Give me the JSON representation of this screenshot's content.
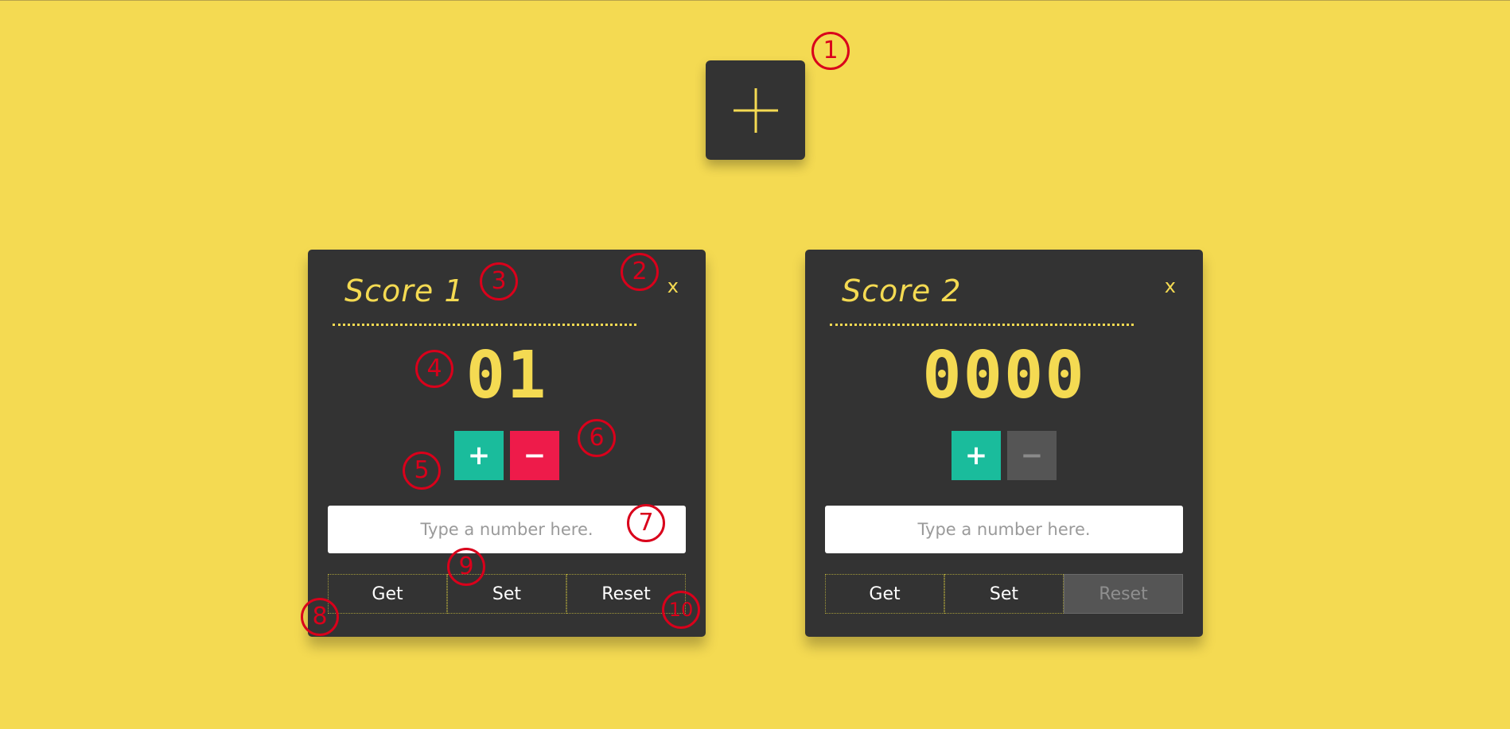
{
  "add_button": {
    "icon": "plus-icon",
    "color": "#f4da52"
  },
  "cards": [
    {
      "title": "Score 1",
      "close_label": "x",
      "score": "01",
      "plus_label": "+",
      "minus_label": "−",
      "minus_enabled": true,
      "input_placeholder": "Type a number here.",
      "input_value": "",
      "get_label": "Get",
      "set_label": "Set",
      "reset_label": "Reset",
      "reset_enabled": true
    },
    {
      "title": "Score 2",
      "close_label": "x",
      "score": "0000",
      "plus_label": "+",
      "minus_label": "−",
      "minus_enabled": false,
      "input_placeholder": "Type a number here.",
      "input_value": "",
      "get_label": "Get",
      "set_label": "Set",
      "reset_label": "Reset",
      "reset_enabled": false
    }
  ],
  "callouts": [
    "1",
    "2",
    "3",
    "4",
    "5",
    "6",
    "7",
    "8",
    "9",
    "10"
  ],
  "colors": {
    "background": "#f4da52",
    "card": "#333333",
    "accent": "#f4da52",
    "plus": "#1abc9c",
    "minus": "#ee1b4a",
    "callout": "#d9001b"
  }
}
